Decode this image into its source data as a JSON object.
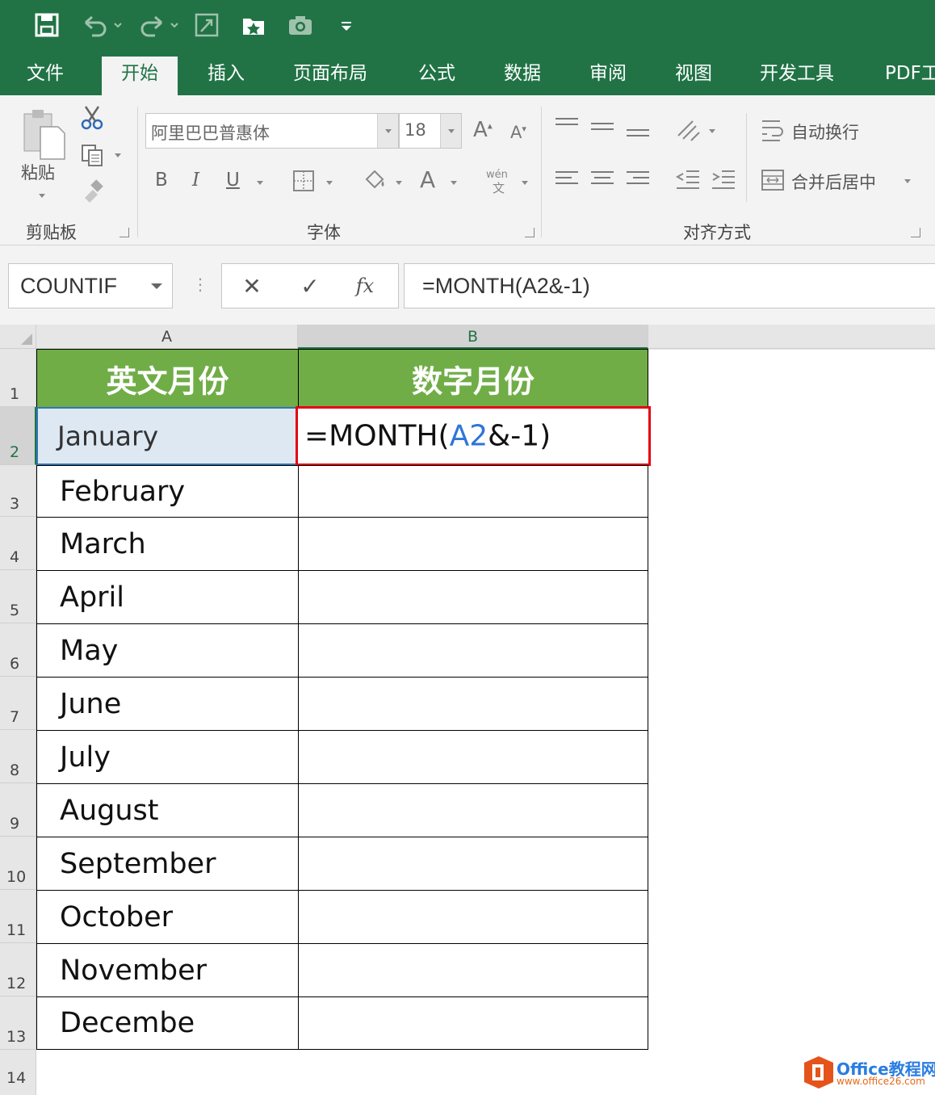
{
  "quick_access": {
    "icons": [
      "save-icon",
      "undo-icon",
      "redo-icon",
      "form-icon",
      "star-folder-icon",
      "camera-icon",
      "customize-qat-icon"
    ]
  },
  "tabs": [
    "文件",
    "开始",
    "插入",
    "页面布局",
    "公式",
    "数据",
    "审阅",
    "视图",
    "开发工具",
    "PDF工"
  ],
  "active_tab": "开始",
  "ribbon": {
    "clipboard": {
      "paste_label": "粘贴",
      "group_label": "剪贴板"
    },
    "font": {
      "font_name": "阿里巴巴普惠体",
      "font_size": "18",
      "bold": "B",
      "italic": "I",
      "underline": "U",
      "grow": "A",
      "shrink": "A",
      "font_color": "A",
      "group_label": "字体"
    },
    "alignment": {
      "wrap_text": "自动换行",
      "merge_center": "合并后居中",
      "group_label": "对齐方式"
    }
  },
  "formula_bar": {
    "name_box": "COUNTIF",
    "cancel": "✕",
    "enter": "✓",
    "fx": "fx",
    "formula": "=MONTH(A2&-1)"
  },
  "sheet": {
    "columns": [
      "A",
      "B"
    ],
    "rows": [
      "1",
      "2",
      "3",
      "4",
      "5",
      "6",
      "7",
      "8",
      "9",
      "10",
      "11",
      "12",
      "13",
      "14"
    ],
    "header_row": {
      "a": "英文月份",
      "b": "数字月份"
    },
    "months": [
      "January",
      "February",
      "March",
      "April",
      "May",
      "June",
      "July",
      "August",
      "September",
      "October",
      "November",
      "Decembe"
    ],
    "editing_cell": {
      "prefix": "=MONTH(",
      "ref": "A2",
      "suffix": "&-1)"
    }
  },
  "colors": {
    "excel_green": "#217346",
    "header_fill": "#70ad47",
    "edit_border": "#e60012",
    "ref_blue": "#2f75d6"
  },
  "watermark": {
    "brand": "Office教程网",
    "url": "www.office26.com"
  }
}
